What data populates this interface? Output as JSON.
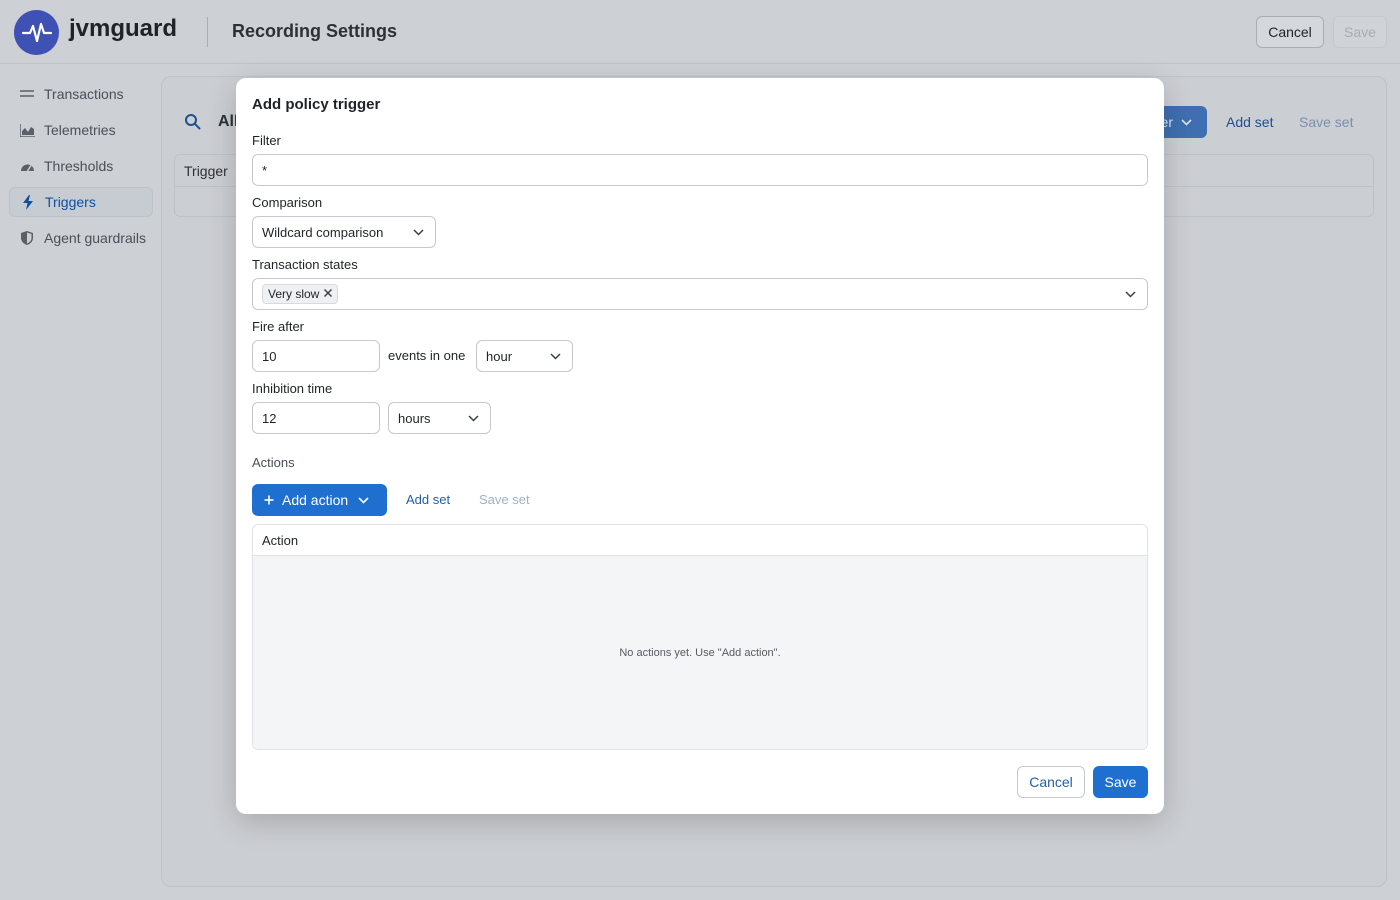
{
  "app": {
    "brand": "jvmguard",
    "page_title": "Recording Settings"
  },
  "header": {
    "cancel_label": "Cancel",
    "save_label": "Save"
  },
  "sidebar": {
    "items": [
      {
        "label": "Transactions",
        "icon": "list-icon"
      },
      {
        "label": "Telemetries",
        "icon": "chart-icon"
      },
      {
        "label": "Thresholds",
        "icon": "gauge-icon"
      },
      {
        "label": "Triggers",
        "icon": "lightning-icon",
        "active": true
      },
      {
        "label": "Agent guardrails",
        "icon": "shield-icon"
      }
    ]
  },
  "background": {
    "search_title": "All",
    "filter_button_label": "er",
    "add_set": "Add set",
    "save_set": "Save set",
    "table_header": "Trigger"
  },
  "modal": {
    "title": "Add policy trigger",
    "filter": {
      "label": "Filter",
      "value": "*"
    },
    "comparison": {
      "label": "Comparison",
      "value": "Wildcard comparison"
    },
    "transaction_states": {
      "label": "Transaction states",
      "chips": [
        "Very slow"
      ]
    },
    "fire_after": {
      "label": "Fire after",
      "count": "10",
      "middle_text": "events in one",
      "unit": "hour"
    },
    "inhibition": {
      "label": "Inhibition time",
      "value": "12",
      "unit": "hours"
    },
    "actions": {
      "label": "Actions",
      "add_action": "Add action",
      "add_set": "Add set",
      "save_set": "Save set",
      "table_header": "Action",
      "empty_text": "No actions yet. Use \"Add action\"."
    },
    "cancel_label": "Cancel",
    "save_label": "Save"
  },
  "colors": {
    "accent": "#1f6fd1",
    "brand": "#3f51b5",
    "link": "#1f5fae"
  }
}
